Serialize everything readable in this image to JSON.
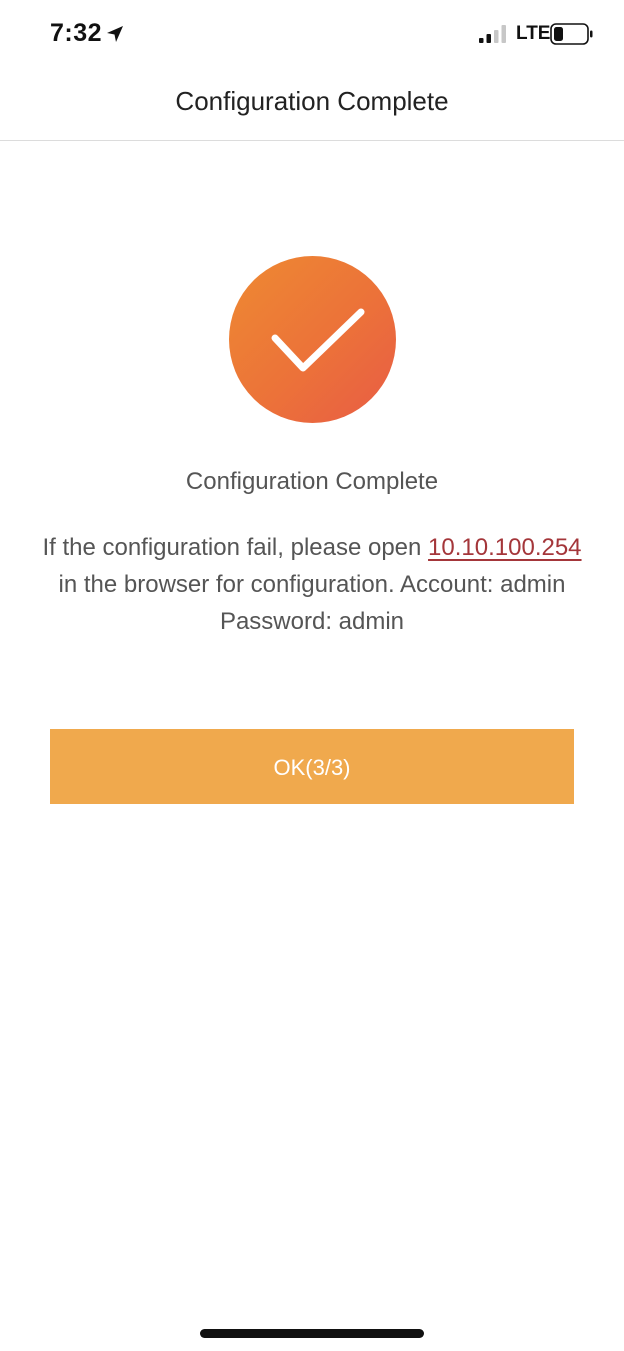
{
  "status_bar": {
    "time": "7:32",
    "network": "LTE",
    "icons": [
      "location-arrow-icon",
      "signal-icon",
      "battery-icon"
    ]
  },
  "nav": {
    "title": "Configuration Complete"
  },
  "content": {
    "icon": "check-circle-icon",
    "status_title": "Configuration Complete",
    "message_prefix": "If the configuration fail, please open ",
    "link_text": "10.10.100.254",
    "message_suffix": " in the browser for configuration. Account: admin Password: admin"
  },
  "actions": {
    "ok_label": "OK(3/3)"
  },
  "colors": {
    "accent_button": "#f0a94d",
    "icon_gradient_start": "#ee8a32",
    "icon_gradient_end": "#e85c45",
    "link": "#a4363a"
  }
}
